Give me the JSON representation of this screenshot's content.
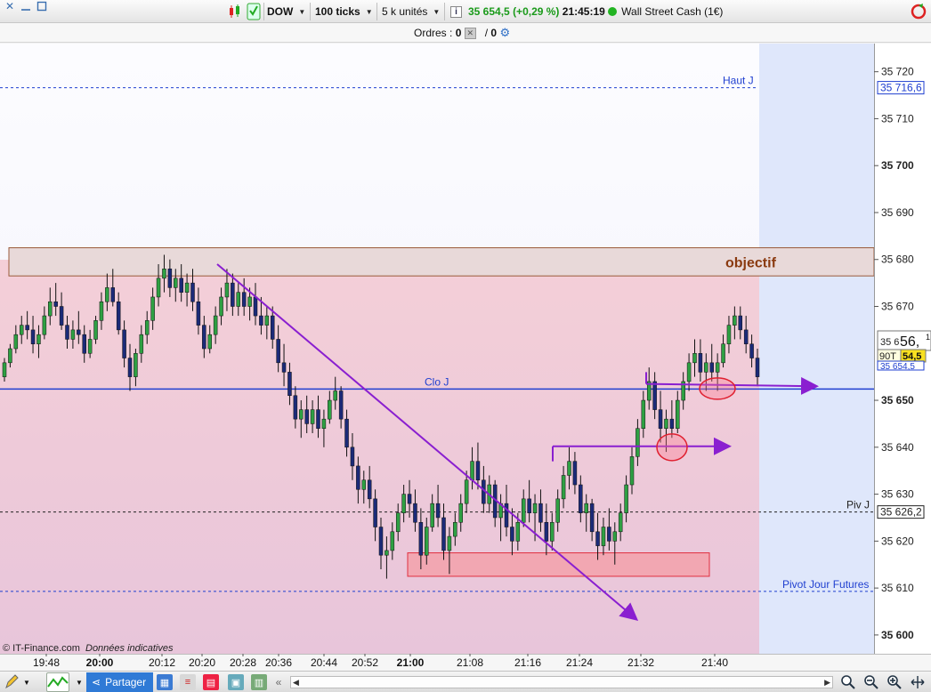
{
  "toolbar": {
    "instrument": "DOW",
    "ticks": "100 ticks",
    "units": "5 k unités",
    "info_icon": "i",
    "price": "35 654,5",
    "change": "(+0,29 %)",
    "time": "21:45:19",
    "market_name": "Wall Street Cash (1€)"
  },
  "orders": {
    "label": "Ordres :",
    "count_a": "0",
    "slash": "/",
    "count_b": "0"
  },
  "chart_data": {
    "type": "candlestick",
    "y_axis": {
      "min": 35596,
      "max": 35726,
      "ticks": [
        35720,
        35710,
        35700,
        35690,
        35680,
        35670,
        35650,
        35640,
        35630,
        35620,
        35610,
        35600
      ],
      "tick_labels": [
        "35 720",
        "35 710",
        "35 700",
        "35 690",
        "35 680",
        "35 670",
        "35 650",
        "35 640",
        "35 630",
        "35 620",
        "35 610",
        "35 600"
      ],
      "bold_ticks": [
        35700,
        35650,
        35600
      ]
    },
    "x_axis": {
      "labels": [
        "19:48",
        "20:00",
        "20:12",
        "20:20",
        "20:28",
        "20:36",
        "20:44",
        "20:52",
        "21:00",
        "21:08",
        "21:16",
        "21:24",
        "21:32",
        "21:40"
      ],
      "bold_labels": [
        "20:00",
        "21:00"
      ]
    },
    "levels": [
      {
        "name": "Haut J",
        "value": 35716.6,
        "label": "35 716,6",
        "color": "#1f3fd0"
      },
      {
        "name": "Clo J",
        "value": 35652.4,
        "label": "35 652,4",
        "color": "#1f3fd0"
      },
      {
        "name": "Piv J",
        "value": 35626.2,
        "label": "35 626,2",
        "color": "#222222"
      },
      {
        "name": "Pivot Jour Futures",
        "value": 35609.3,
        "label": "",
        "color": "#1f3fd0"
      }
    ],
    "last_price": {
      "big": "35 656,",
      "small": "1",
      "candle_tag": "90T",
      "value_tag": "54,5",
      "value": 35654.5,
      "hidden_labels": [
        "35 6",
        "35 654,5"
      ]
    },
    "annotations": {
      "objectif": "objectif"
    },
    "candles": [
      [
        35655,
        35659,
        35654,
        35658
      ],
      [
        35658,
        35662,
        35657,
        35661
      ],
      [
        35661,
        35666,
        35660,
        35664
      ],
      [
        35664,
        35668,
        35662,
        35666
      ],
      [
        35666,
        35669,
        35663,
        35665
      ],
      [
        35665,
        35668,
        35660,
        35662
      ],
      [
        35662,
        35666,
        35659,
        35664
      ],
      [
        35664,
        35670,
        35663,
        35668
      ],
      [
        35668,
        35674,
        35666,
        35671
      ],
      [
        35671,
        35675,
        35668,
        35670
      ],
      [
        35670,
        35673,
        35665,
        35666
      ],
      [
        35666,
        35668,
        35661,
        35663
      ],
      [
        35663,
        35667,
        35661,
        35665
      ],
      [
        35665,
        35669,
        35662,
        35664
      ],
      [
        35664,
        35666,
        35658,
        35660
      ],
      [
        35660,
        35665,
        35659,
        35663
      ],
      [
        35663,
        35668,
        35662,
        35667
      ],
      [
        35667,
        35673,
        35665,
        35671
      ],
      [
        35671,
        35677,
        35669,
        35674
      ],
      [
        35674,
        35678,
        35670,
        35671
      ],
      [
        35671,
        35673,
        35664,
        35665
      ],
      [
        35665,
        35667,
        35657,
        35659
      ],
      [
        35659,
        35662,
        35652,
        35655
      ],
      [
        35655,
        35661,
        35653,
        35660
      ],
      [
        35660,
        35666,
        35658,
        35664
      ],
      [
        35664,
        35669,
        35662,
        35667
      ],
      [
        35667,
        35674,
        35665,
        35672
      ],
      [
        35672,
        35679,
        35670,
        35676
      ],
      [
        35676,
        35681,
        35673,
        35678
      ],
      [
        35678,
        35680,
        35672,
        35674
      ],
      [
        35674,
        35678,
        35671,
        35676
      ],
      [
        35676,
        35679,
        35671,
        35673
      ],
      [
        35673,
        35677,
        35670,
        35675
      ],
      [
        35675,
        35678,
        35669,
        35671
      ],
      [
        35671,
        35674,
        35664,
        35666
      ],
      [
        35666,
        35668,
        35659,
        35661
      ],
      [
        35661,
        35666,
        35660,
        35664
      ],
      [
        35664,
        35670,
        35662,
        35668
      ],
      [
        35668,
        35674,
        35666,
        35672
      ],
      [
        35672,
        35678,
        35669,
        35675
      ],
      [
        35675,
        35677,
        35668,
        35670
      ],
      [
        35670,
        35675,
        35668,
        35673
      ],
      [
        35673,
        35676,
        35668,
        35670
      ],
      [
        35670,
        35674,
        35667,
        35672
      ],
      [
        35672,
        35675,
        35666,
        35668
      ],
      [
        35668,
        35672,
        35664,
        35666
      ],
      [
        35666,
        35670,
        35663,
        35668
      ],
      [
        35668,
        35670,
        35661,
        35663
      ],
      [
        35663,
        35666,
        35656,
        35658
      ],
      [
        35658,
        35662,
        35653,
        35656
      ],
      [
        35656,
        35658,
        35649,
        35651
      ],
      [
        35651,
        35653,
        35644,
        35646
      ],
      [
        35646,
        35650,
        35642,
        35648
      ],
      [
        35648,
        35651,
        35643,
        35645
      ],
      [
        35645,
        35650,
        35643,
        35648
      ],
      [
        35648,
        35651,
        35642,
        35644
      ],
      [
        35644,
        35648,
        35640,
        35646
      ],
      [
        35646,
        35652,
        35645,
        35650
      ],
      [
        35650,
        35655,
        35648,
        35652
      ],
      [
        35652,
        35653,
        35644,
        35646
      ],
      [
        35646,
        35648,
        35638,
        35640
      ],
      [
        35640,
        35643,
        35633,
        35636
      ],
      [
        35636,
        35638,
        35628,
        35631
      ],
      [
        35631,
        35635,
        35628,
        35633
      ],
      [
        35633,
        35636,
        35627,
        35629
      ],
      [
        35629,
        35631,
        35620,
        35623
      ],
      [
        35623,
        35625,
        35614,
        35617
      ],
      [
        35617,
        35621,
        35612,
        35618
      ],
      [
        35618,
        35624,
        35616,
        35622
      ],
      [
        35622,
        35628,
        35620,
        35626
      ],
      [
        35626,
        35632,
        35624,
        35630
      ],
      [
        35630,
        35633,
        35625,
        35628
      ],
      [
        35628,
        35631,
        35622,
        35624
      ],
      [
        35624,
        35627,
        35614,
        35617
      ],
      [
        35617,
        35625,
        35615,
        35623
      ],
      [
        35623,
        35630,
        35622,
        35628
      ],
      [
        35628,
        35632,
        35623,
        35625
      ],
      [
        35625,
        35628,
        35616,
        35618
      ],
      [
        35618,
        35623,
        35613,
        35621
      ],
      [
        35621,
        35626,
        35619,
        35624
      ],
      [
        35624,
        35630,
        35622,
        35628
      ],
      [
        35628,
        35635,
        35626,
        35633
      ],
      [
        35633,
        35640,
        35631,
        35637
      ],
      [
        35637,
        35641,
        35631,
        35633
      ],
      [
        35633,
        35636,
        35626,
        35628
      ],
      [
        35628,
        35634,
        35626,
        35632
      ],
      [
        35632,
        35633,
        35623,
        35625
      ],
      [
        35625,
        35630,
        35620,
        35628
      ],
      [
        35628,
        35632,
        35621,
        35623
      ],
      [
        35623,
        35627,
        35617,
        35620
      ],
      [
        35620,
        35626,
        35618,
        35624
      ],
      [
        35624,
        35631,
        35623,
        35629
      ],
      [
        35629,
        35633,
        35624,
        35626
      ],
      [
        35626,
        35630,
        35620,
        35628
      ],
      [
        35628,
        35631,
        35622,
        35624
      ],
      [
        35624,
        35628,
        35617,
        35620
      ],
      [
        35620,
        35626,
        35618,
        35624
      ],
      [
        35624,
        35631,
        35622,
        35629
      ],
      [
        35629,
        35636,
        35627,
        35634
      ],
      [
        35634,
        35640,
        35631,
        35637
      ],
      [
        35637,
        35639,
        35630,
        35632
      ],
      [
        35632,
        35634,
        35624,
        35626
      ],
      [
        35626,
        35630,
        35622,
        35628
      ],
      [
        35628,
        35629,
        35620,
        35622
      ],
      [
        35622,
        35626,
        35616,
        35619
      ],
      [
        35619,
        35625,
        35617,
        35623
      ],
      [
        35623,
        35627,
        35618,
        35620
      ],
      [
        35620,
        35624,
        35615,
        35622
      ],
      [
        35622,
        35628,
        35620,
        35626
      ],
      [
        35626,
        35634,
        35624,
        35632
      ],
      [
        35632,
        35640,
        35630,
        35638
      ],
      [
        35638,
        35646,
        35636,
        35644
      ],
      [
        35644,
        35652,
        35642,
        35650
      ],
      [
        35650,
        35657,
        35648,
        35654
      ],
      [
        35654,
        35656,
        35646,
        35648
      ],
      [
        35648,
        35652,
        35641,
        35644
      ],
      [
        35644,
        35648,
        35639,
        35646
      ],
      [
        35646,
        35650,
        35642,
        35644
      ],
      [
        35644,
        35652,
        35643,
        35650
      ],
      [
        35650,
        35656,
        35648,
        35654
      ],
      [
        35654,
        35660,
        35652,
        35658
      ],
      [
        35658,
        35663,
        35655,
        35660
      ],
      [
        35660,
        35663,
        35654,
        35656
      ],
      [
        35656,
        35660,
        35652,
        35658
      ],
      [
        35658,
        35662,
        35654,
        35656
      ],
      [
        35656,
        35660,
        35652,
        35658
      ],
      [
        35658,
        35664,
        35657,
        35662
      ],
      [
        35662,
        35668,
        35660,
        35666
      ],
      [
        35666,
        35670,
        35663,
        35668
      ],
      [
        35668,
        35670,
        35663,
        35665
      ],
      [
        35665,
        35668,
        35660,
        35662
      ],
      [
        35662,
        35664,
        35657,
        35659
      ],
      [
        35659,
        35661,
        35653,
        35655
      ]
    ]
  }
}
